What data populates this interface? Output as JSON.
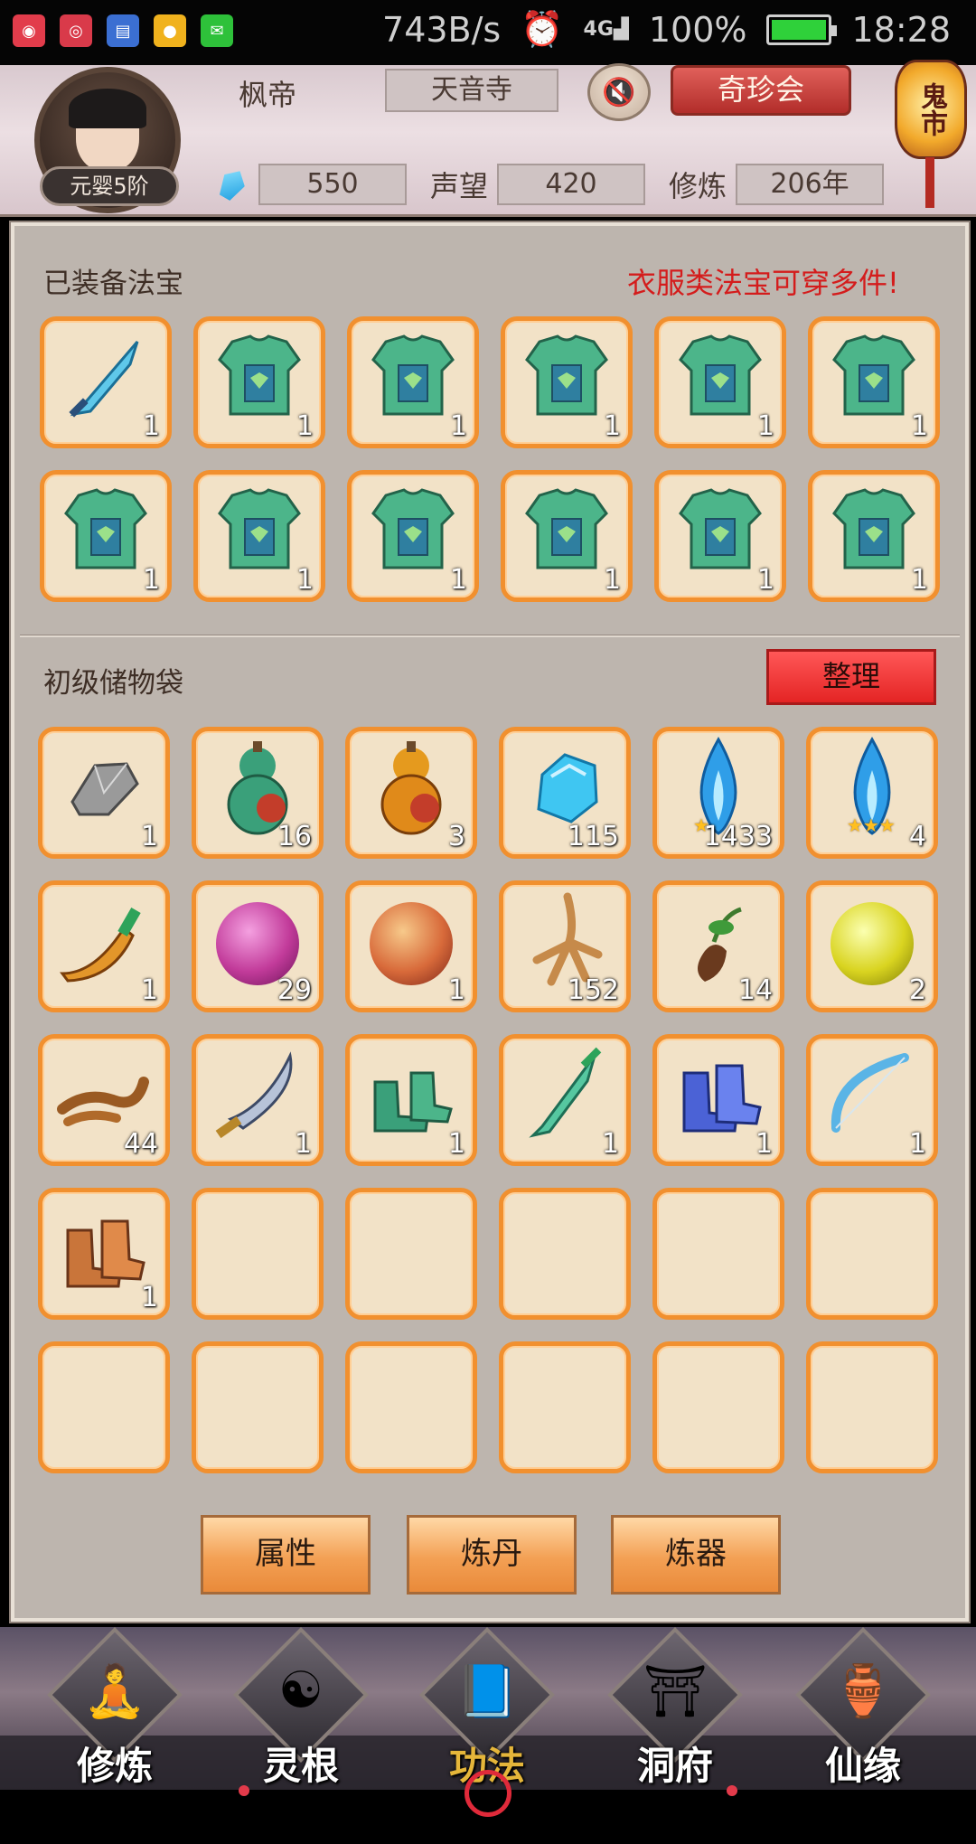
{
  "status_bar": {
    "network_speed": "743B/s",
    "signal": "4G",
    "battery": "100%",
    "time": "18:28"
  },
  "header": {
    "player_name": "枫帝",
    "realm": "元婴5阶",
    "sect": "天音寺",
    "treasure_button": "奇珍会",
    "lantern_text": "鬼市",
    "gems": "550",
    "reputation_label": "声望",
    "reputation_value": "420",
    "cultivation_label": "修炼",
    "cultivation_value": "206年"
  },
  "equipped": {
    "title": "已装备法宝",
    "note": "衣服类法宝可穿多件!",
    "slots": [
      {
        "icon": "dagger-icon",
        "count": "1"
      },
      {
        "icon": "armor-icon",
        "count": "1"
      },
      {
        "icon": "armor-icon",
        "count": "1"
      },
      {
        "icon": "armor-icon",
        "count": "1"
      },
      {
        "icon": "armor-icon",
        "count": "1"
      },
      {
        "icon": "armor-icon",
        "count": "1"
      },
      {
        "icon": "armor-icon",
        "count": "1"
      },
      {
        "icon": "armor-icon",
        "count": "1"
      },
      {
        "icon": "armor-icon",
        "count": "1"
      },
      {
        "icon": "armor-icon",
        "count": "1"
      },
      {
        "icon": "armor-icon",
        "count": "1"
      },
      {
        "icon": "armor-icon",
        "count": "1"
      }
    ]
  },
  "bag": {
    "title": "初级储物袋",
    "sort_button": "整理",
    "slots": [
      {
        "icon": "ore-icon",
        "count": "1"
      },
      {
        "icon": "green-gourd-icon",
        "count": "16"
      },
      {
        "icon": "orange-gourd-icon",
        "count": "3"
      },
      {
        "icon": "blue-crystal-icon",
        "count": "115"
      },
      {
        "icon": "blue-flame-icon",
        "count": "1433",
        "stars": "★"
      },
      {
        "icon": "blue-flame-icon",
        "count": "4",
        "stars": "★★★"
      },
      {
        "icon": "golden-dagger-icon",
        "count": "1"
      },
      {
        "icon": "purple-orb-icon",
        "count": "29"
      },
      {
        "icon": "red-orb-icon",
        "count": "1"
      },
      {
        "icon": "ginseng-icon",
        "count": "152"
      },
      {
        "icon": "herb-root-icon",
        "count": "14"
      },
      {
        "icon": "yellow-orb-icon",
        "count": "2"
      },
      {
        "icon": "cordyceps-icon",
        "count": "44"
      },
      {
        "icon": "broadsword-icon",
        "count": "1"
      },
      {
        "icon": "green-boots-icon",
        "count": "1"
      },
      {
        "icon": "jade-sword-icon",
        "count": "1"
      },
      {
        "icon": "blue-boots-icon",
        "count": "1"
      },
      {
        "icon": "bow-icon",
        "count": "1"
      },
      {
        "icon": "brown-boots-icon",
        "count": "1"
      },
      {
        "icon": "",
        "count": ""
      },
      {
        "icon": "",
        "count": ""
      },
      {
        "icon": "",
        "count": ""
      },
      {
        "icon": "",
        "count": ""
      },
      {
        "icon": "",
        "count": ""
      },
      {
        "icon": "",
        "count": ""
      },
      {
        "icon": "",
        "count": ""
      },
      {
        "icon": "",
        "count": ""
      },
      {
        "icon": "",
        "count": ""
      },
      {
        "icon": "",
        "count": ""
      },
      {
        "icon": "",
        "count": ""
      }
    ]
  },
  "actions": {
    "attributes": "属性",
    "alchemy": "炼丹",
    "forging": "炼器"
  },
  "nav": [
    {
      "label": "修炼",
      "icon": "monk-icon"
    },
    {
      "label": "灵根",
      "icon": "yin-yang-sword-icon"
    },
    {
      "label": "功法",
      "icon": "scripture-book-icon",
      "active": true
    },
    {
      "label": "洞府",
      "icon": "pavilion-icon"
    },
    {
      "label": "仙缘",
      "icon": "gourd-icon"
    }
  ],
  "colors": {
    "slot_border": "#f1902f",
    "slot_bg": "#f2e2c7",
    "note_red": "#d41c1c",
    "active_nav": "#e5b63a"
  }
}
